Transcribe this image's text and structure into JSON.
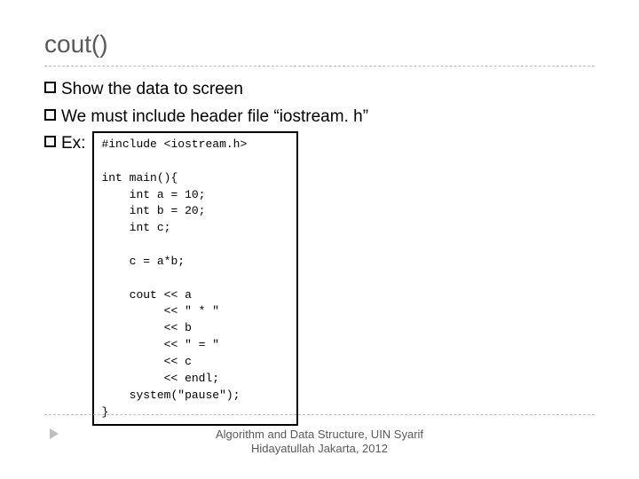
{
  "title": "cout()",
  "bullets": {
    "b1": "Show the data to screen",
    "b2": "We must include header file “iostream. h”",
    "b3": "Ex:"
  },
  "code": "#include <iostream.h>\n\nint main(){\n    int a = 10;\n    int b = 20;\n    int c;\n\n    c = a*b;\n\n    cout << a\n         << \" * \"\n         << b\n         << \" = \"\n         << c\n         << endl;\n    system(\"pause\");\n}",
  "footer": {
    "line1": "Algorithm and Data Structure, UIN Syarif",
    "line2": "Hidayatullah Jakarta, 2012"
  }
}
